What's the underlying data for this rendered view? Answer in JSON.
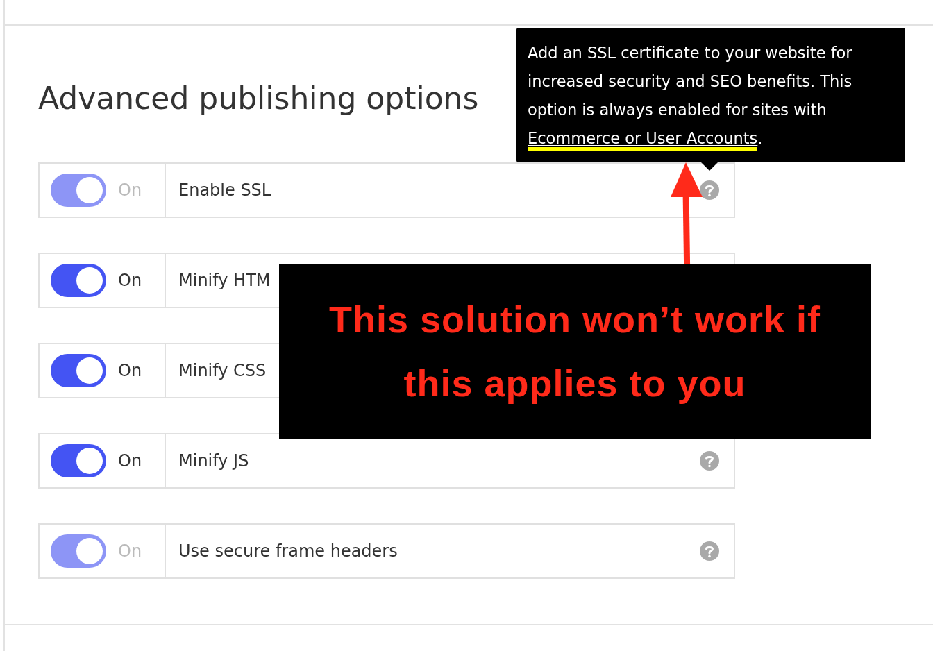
{
  "heading": "Advanced publishing options",
  "options": [
    {
      "state_label": "On",
      "on": true,
      "disabled": true,
      "label": "Enable SSL",
      "help": true
    },
    {
      "state_label": "On",
      "on": true,
      "disabled": false,
      "label": "Minify HTM",
      "help": false
    },
    {
      "state_label": "On",
      "on": true,
      "disabled": false,
      "label": "Minify CSS",
      "help": false
    },
    {
      "state_label": "On",
      "on": true,
      "disabled": false,
      "label": "Minify JS",
      "help": true
    },
    {
      "state_label": "On",
      "on": true,
      "disabled": true,
      "label": "Use secure frame headers",
      "help": true
    }
  ],
  "tooltip": {
    "text": "Add an SSL certificate to your website for increased security and SEO benefits. This option is always enabled for sites with ",
    "link": "Ecommerce or User Accounts",
    "after": "."
  },
  "annotation": {
    "callout": "This solution won’t work if this applies to you"
  }
}
